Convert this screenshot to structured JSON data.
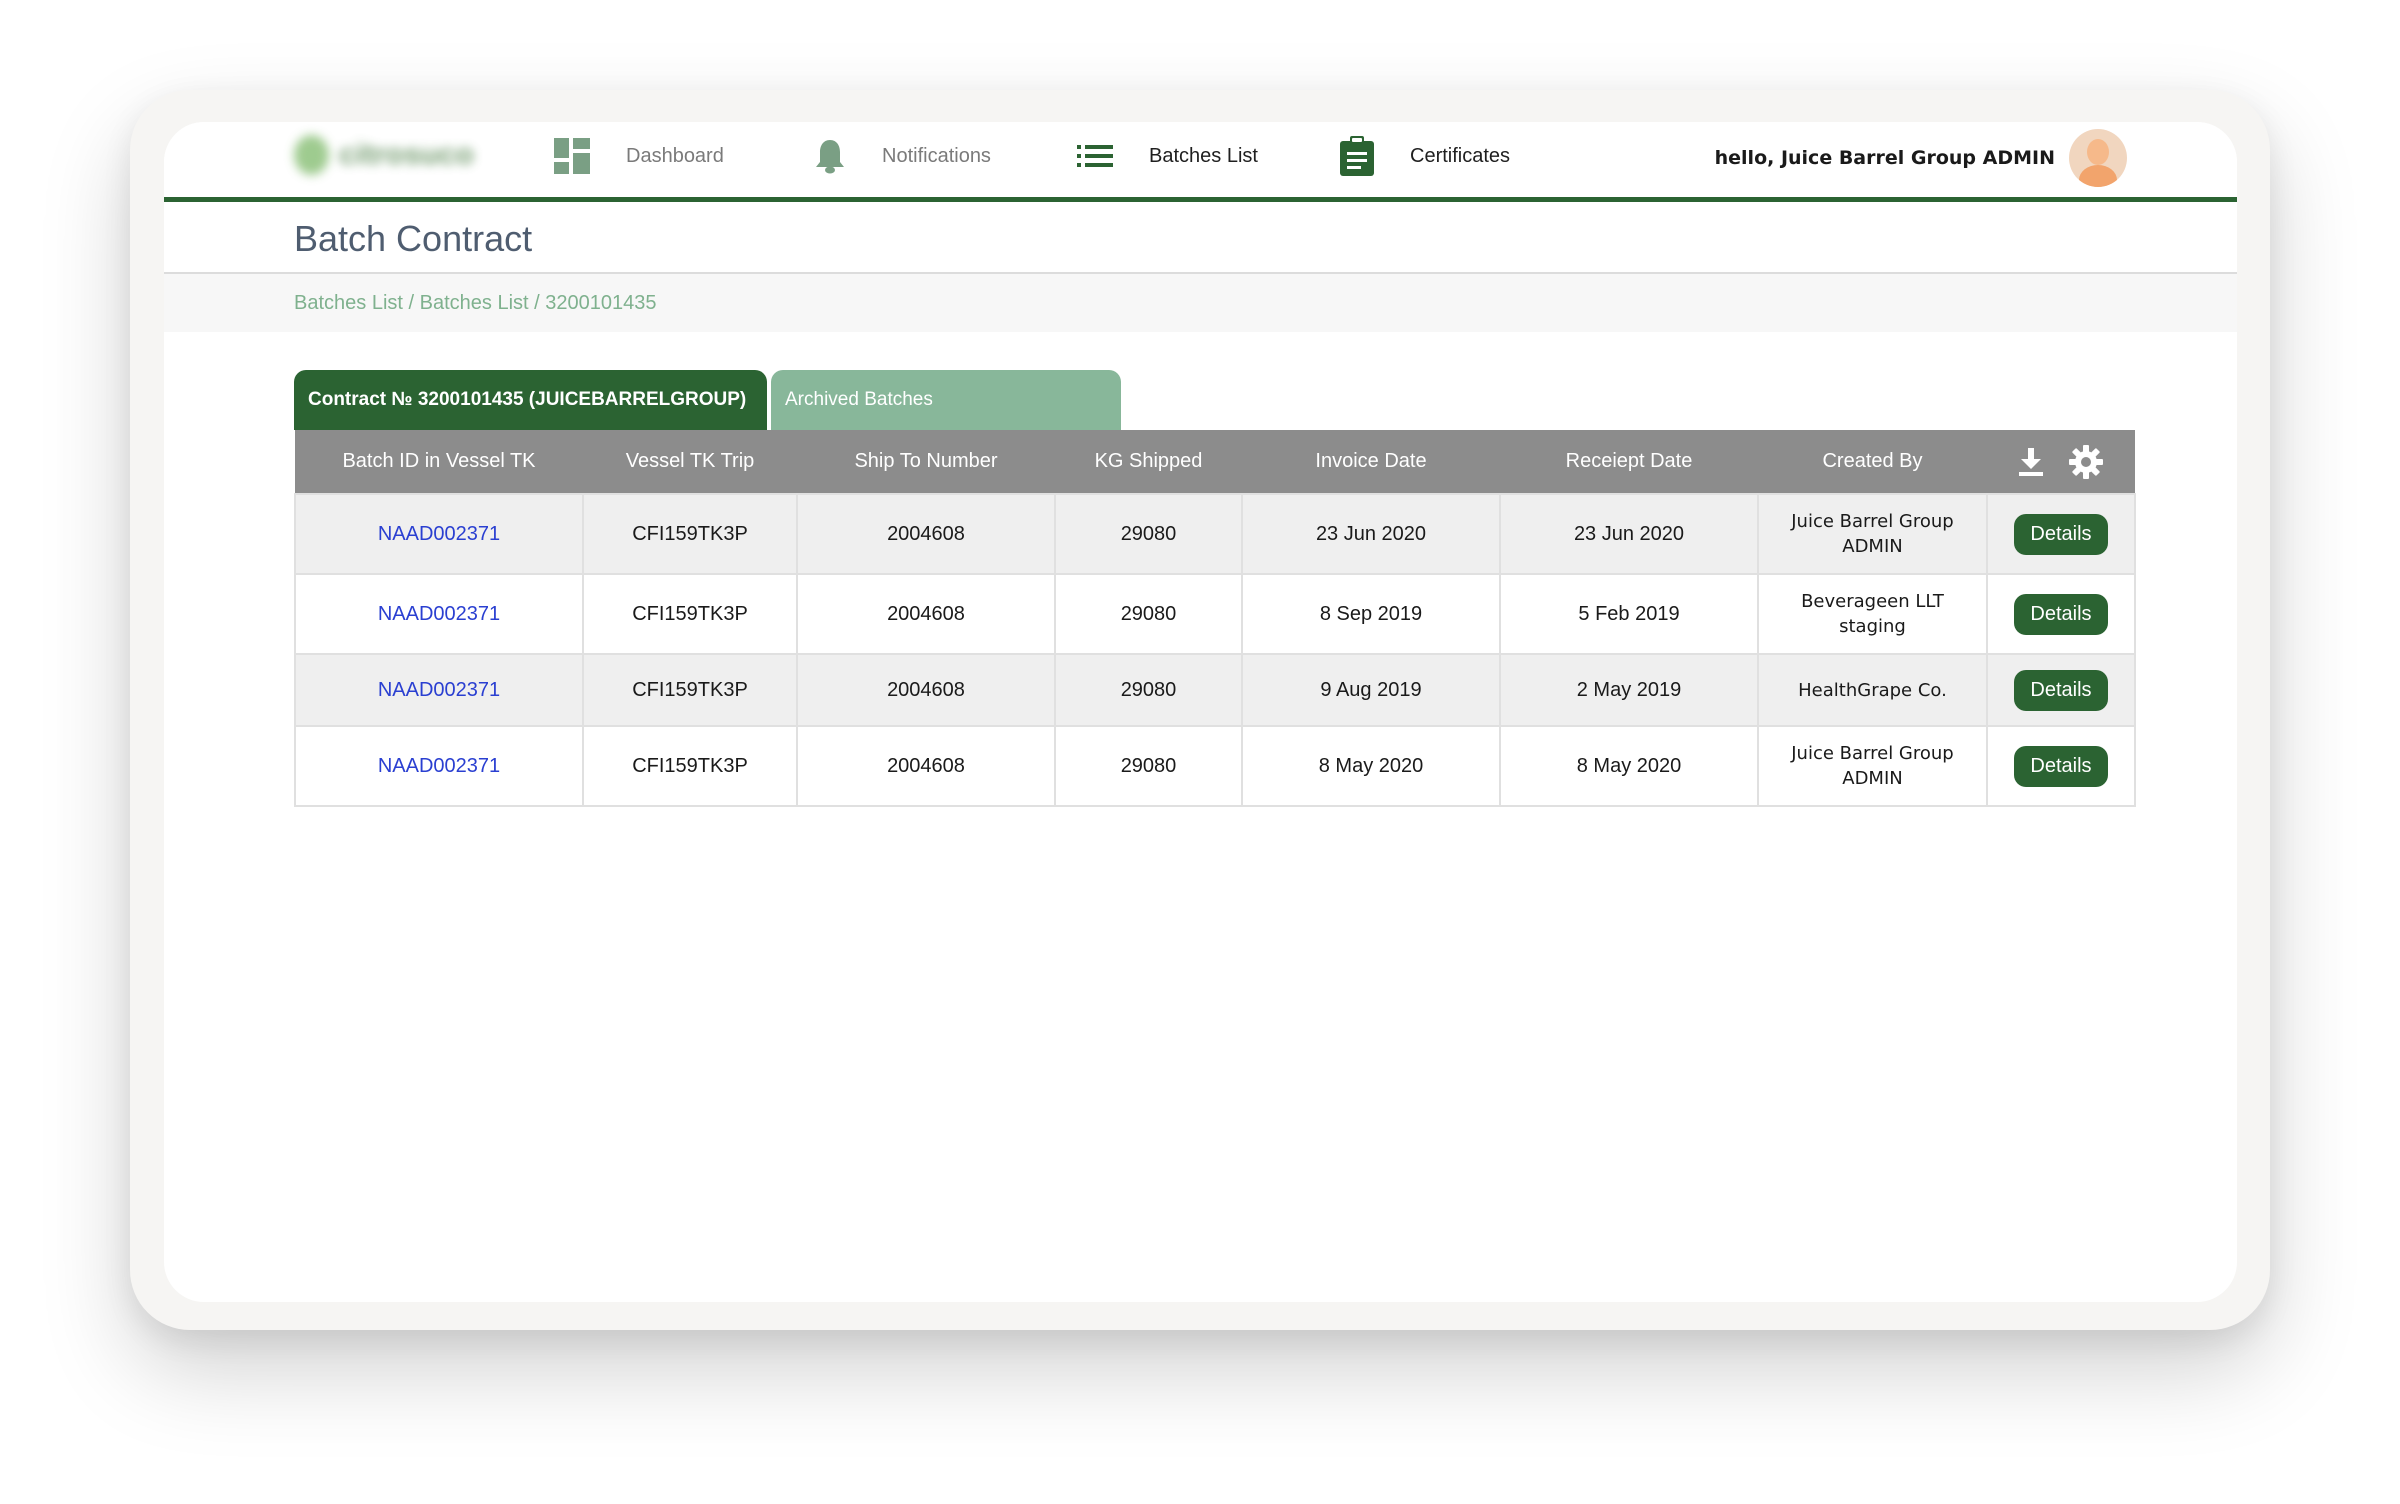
{
  "nav": {
    "logo_text": "citrosuco",
    "items": [
      {
        "label": "Dashboard",
        "icon": "dashboard-icon"
      },
      {
        "label": "Notifications",
        "icon": "bell-icon"
      },
      {
        "label": "Batches List",
        "icon": "list-icon"
      },
      {
        "label": "Certificates",
        "icon": "clipboard-icon"
      }
    ],
    "greeting": "hello, Juice Barrel Group ADMIN"
  },
  "page": {
    "title": "Batch Contract",
    "breadcrumb": [
      "Batches List",
      "Batches List",
      "3200101435"
    ]
  },
  "tabs": [
    {
      "label": "Contract № 3200101435 (JUICEBARRELGROUP)",
      "active": true
    },
    {
      "label": "Archived Batches",
      "active": false
    }
  ],
  "table": {
    "columns": [
      "Batch ID in Vessel TK",
      "Vessel TK Trip",
      "Ship To Number",
      "KG Shipped",
      "Invoice Date",
      "Receiept Date",
      "Created By"
    ],
    "header_icons": [
      "download-icon",
      "gear-icon"
    ],
    "action_label": "Details",
    "rows": [
      {
        "batch_id": "NAAD002371",
        "trip": "CFI159TK3P",
        "ship_to": "2004608",
        "kg": "29080",
        "invoice": "23 Jun 2020",
        "receipt": "23 Jun 2020",
        "created_by": [
          "Juice Barrel Group",
          "ADMIN"
        ]
      },
      {
        "batch_id": "NAAD002371",
        "trip": "CFI159TK3P",
        "ship_to": "2004608",
        "kg": "29080",
        "invoice": "8 Sep 2019",
        "receipt": "5 Feb 2019",
        "created_by": [
          "Beverageen LLT",
          "staging"
        ]
      },
      {
        "batch_id": "NAAD002371",
        "trip": "CFI159TK3P",
        "ship_to": "2004608",
        "kg": "29080",
        "invoice": "9 Aug 2019",
        "receipt": "2 May 2019",
        "created_by": [
          "HealthGrape Co.",
          ""
        ]
      },
      {
        "batch_id": "NAAD002371",
        "trip": "CFI159TK3P",
        "ship_to": "2004608",
        "kg": "29080",
        "invoice": "8 May 2020",
        "receipt": "8 May 2020",
        "created_by": [
          "Juice Barrel Group",
          "ADMIN"
        ]
      }
    ]
  },
  "colors": {
    "brand_green": "#2b6332",
    "tab_inactive": "#88b79a",
    "header_gray": "#8c8c8c",
    "link_blue": "#2a3fd1",
    "breadcrumb": "#7fb18e"
  }
}
